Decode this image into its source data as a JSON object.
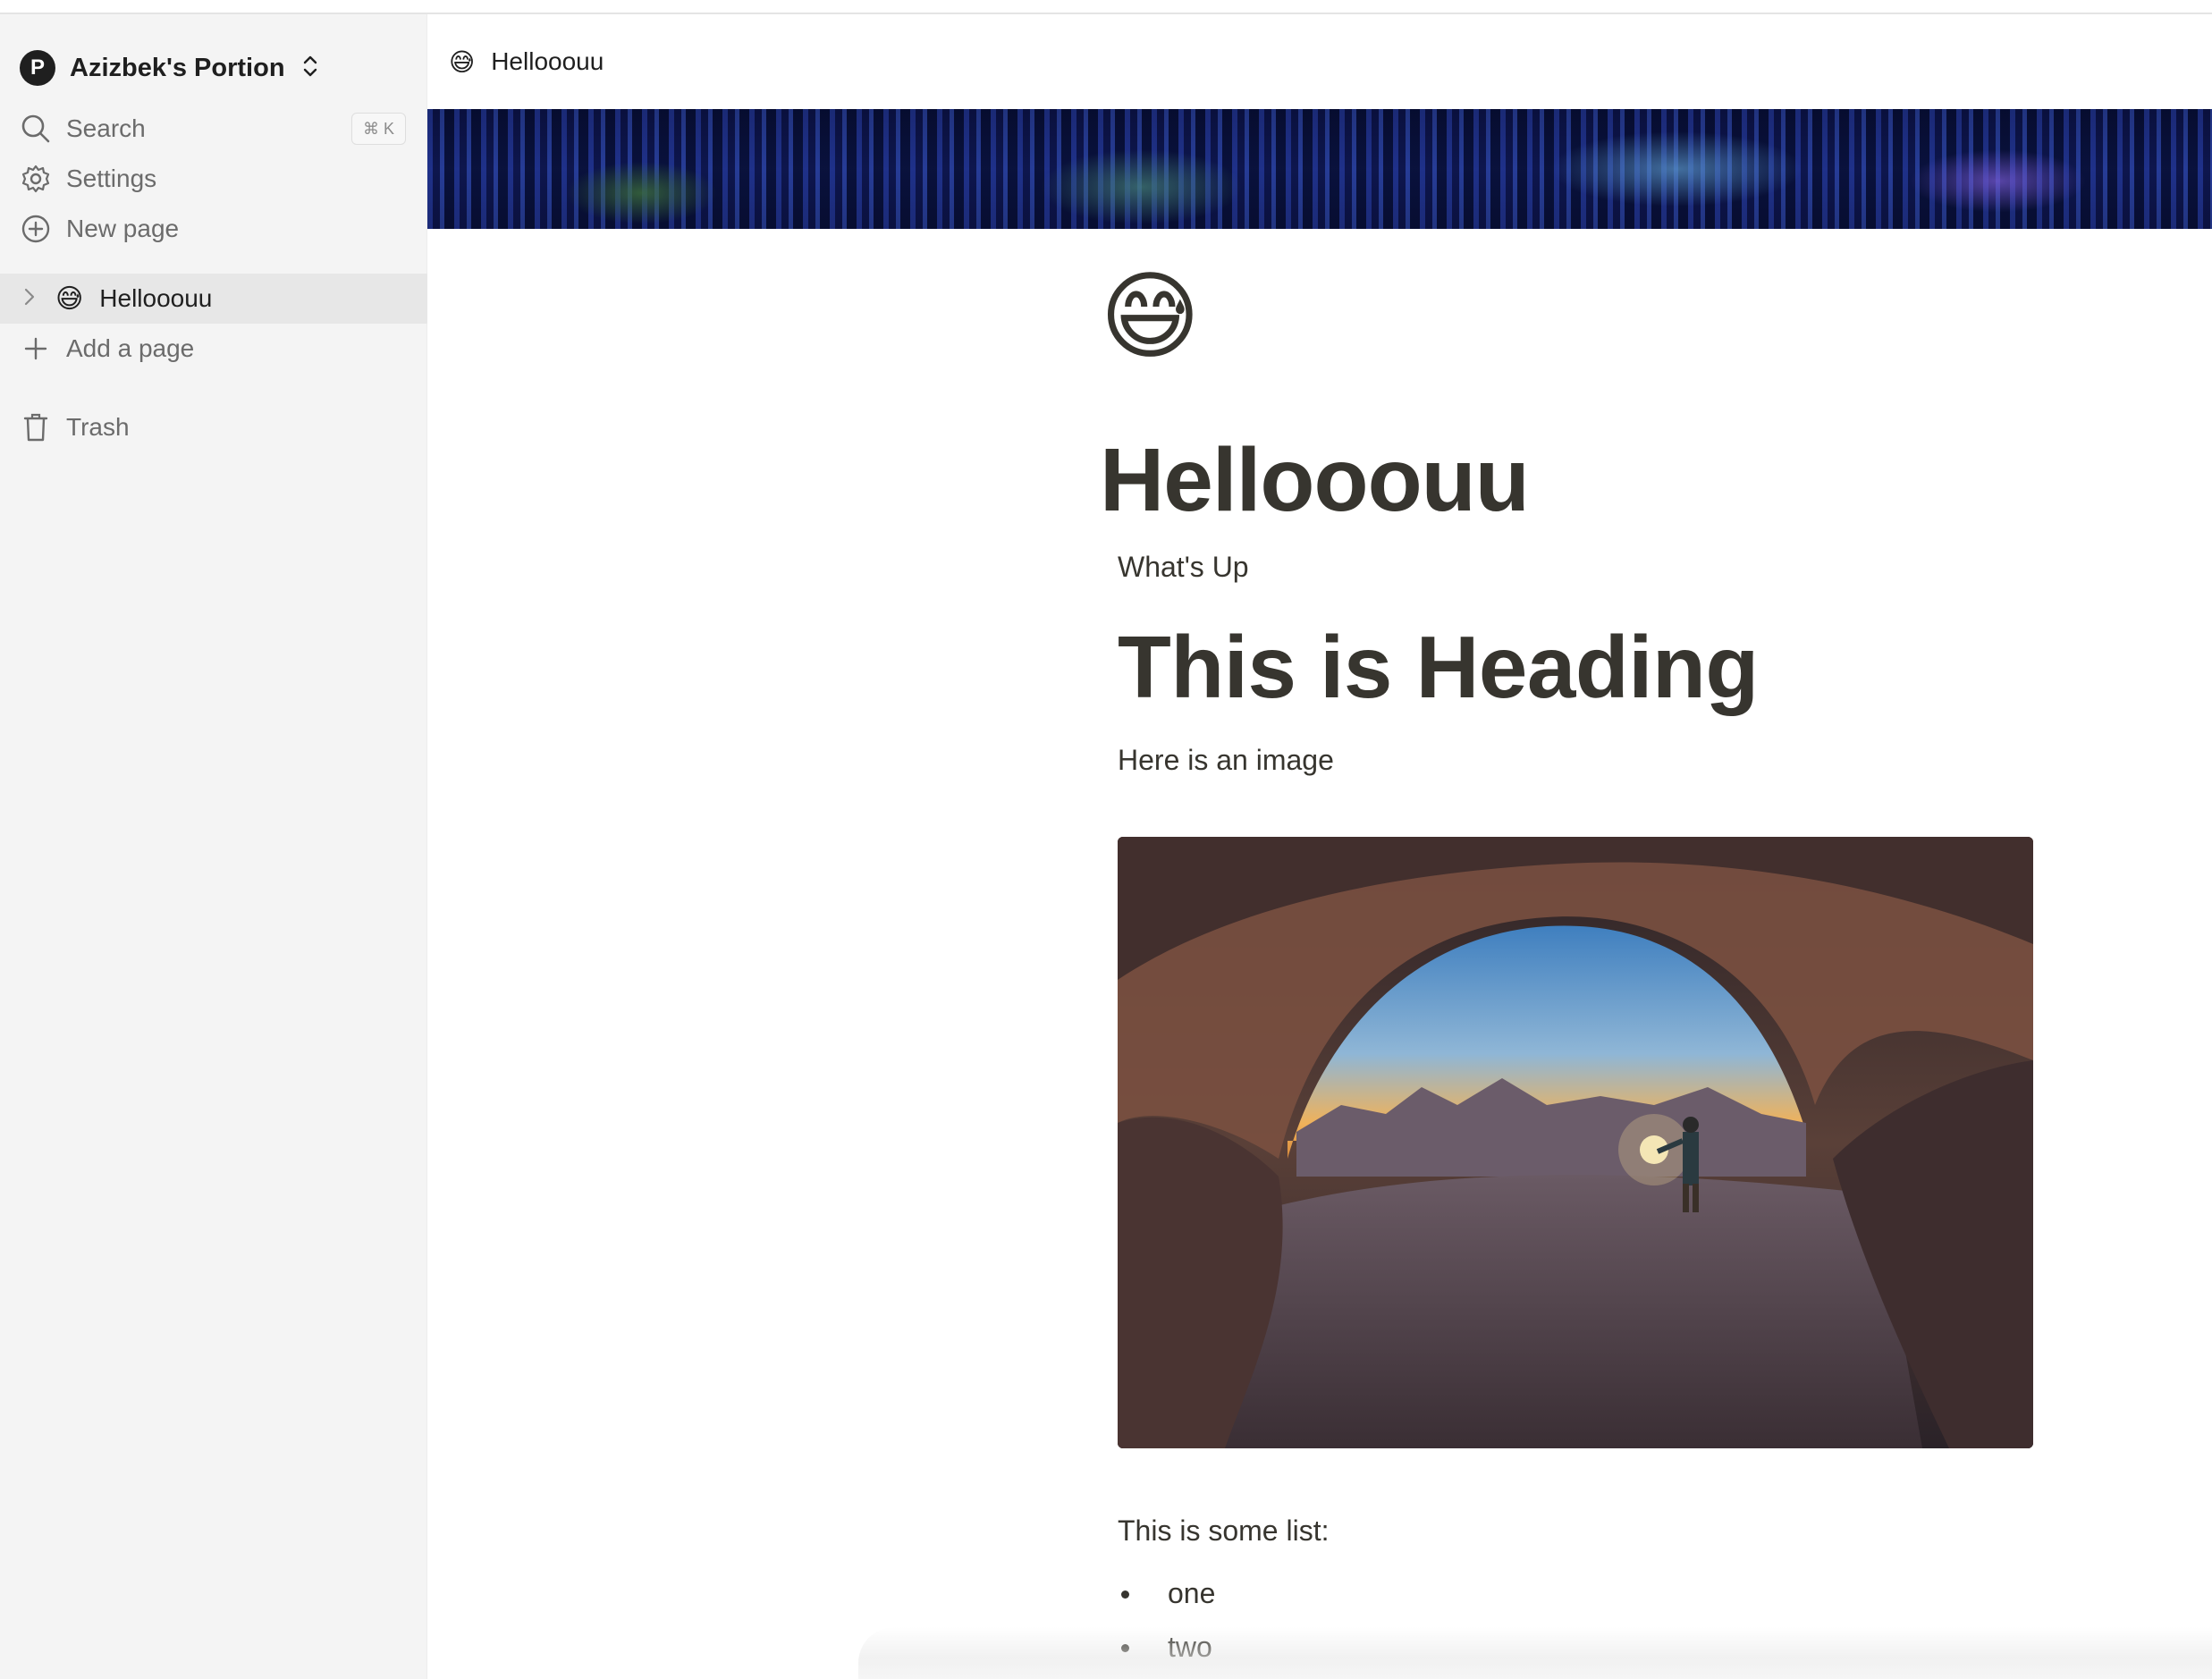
{
  "workspace": {
    "name": "Azizbek's Portion",
    "logo_letter": "P"
  },
  "nav": {
    "search_label": "Search",
    "search_shortcut": "⌘ K",
    "settings_label": "Settings",
    "new_page_label": "New page"
  },
  "pages": [
    {
      "emoji": "😅",
      "title": "Hellooouu"
    }
  ],
  "add_page_label": "Add a page",
  "trash_label": "Trash",
  "tab": {
    "emoji": "😅",
    "title": "Hellooouu"
  },
  "document": {
    "emoji": "😅",
    "title": "Hellooouu",
    "subtitle": "What's Up",
    "heading": "This is Heading",
    "paragraph": "Here is an image",
    "list_intro": "This is some list:",
    "list_items": [
      "one",
      "two"
    ]
  },
  "colors": {
    "sidebar_bg": "#f4f4f4",
    "active_item_bg": "#e7e7e7",
    "text": "#37352f"
  }
}
